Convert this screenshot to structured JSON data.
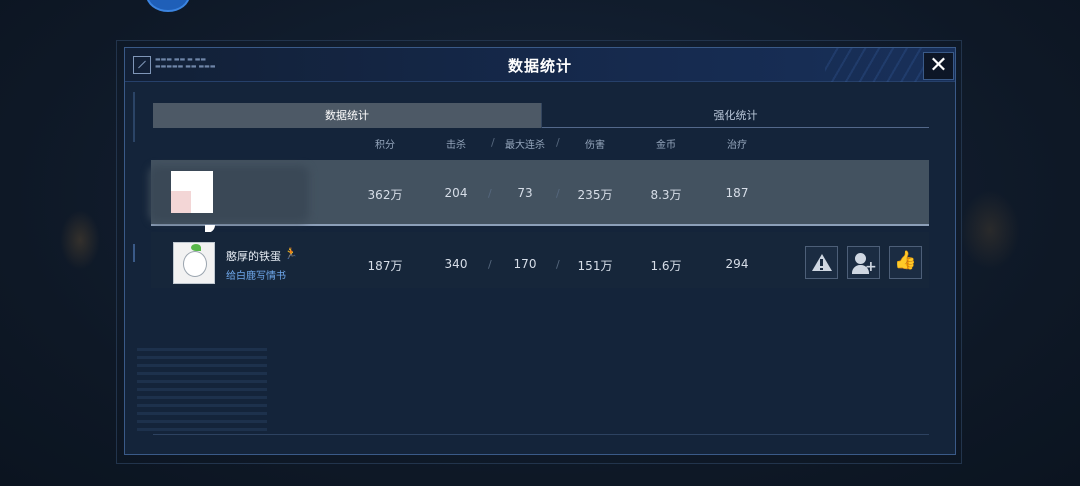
{
  "dialog": {
    "title": "数据统计",
    "close_glyph": "✕"
  },
  "tabs": [
    {
      "label": "数据统计",
      "active": true
    },
    {
      "label": "强化统计",
      "active": false
    }
  ],
  "columns": [
    "积分",
    "击杀",
    "最大连杀",
    "伤害",
    "金币",
    "治疗"
  ],
  "rows": [
    {
      "name": "",
      "subtitle": "",
      "score": "362万",
      "kills": "204",
      "max_streak": "73",
      "damage": "235万",
      "gold": "8.3万",
      "heal": "187",
      "highlighted": true
    },
    {
      "name": "憨厚的铁蛋",
      "name_icon": "🏃",
      "subtitle": "给白鹿写情书",
      "score": "187万",
      "kills": "340",
      "max_streak": "170",
      "damage": "151万",
      "gold": "1.6万",
      "heal": "294",
      "highlighted": false
    }
  ],
  "actions": {
    "report_icon": "warning-icon",
    "add_friend_icon": "add-friend-icon",
    "like_glyph": "👍"
  },
  "colors": {
    "panel_bg": "#14243a",
    "active_tab": "#4d5966",
    "highlight_row": "#435260",
    "subtitle_blue": "#6fa8ec"
  }
}
